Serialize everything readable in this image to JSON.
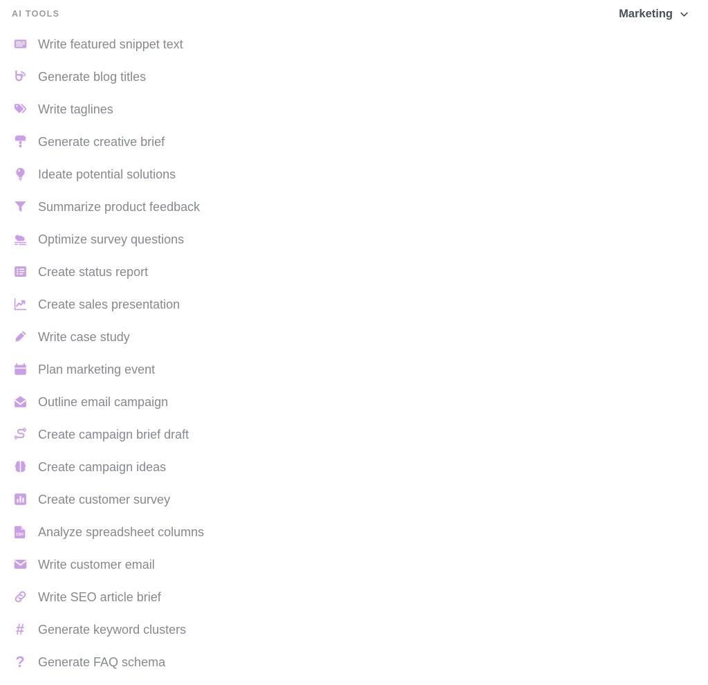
{
  "header": {
    "title": "AI TOOLS",
    "category": {
      "selected": "Marketing",
      "chevron_icon": "chevron-down-icon"
    }
  },
  "colors": {
    "icon_purple": "#c9a0e8",
    "label_gray": "#86888e",
    "title_gray": "#9a9aa2",
    "select_gray": "#4b4f58",
    "background": "#ffffff"
  },
  "tools": [
    {
      "label": "Write featured snippet text",
      "icon": "snippet-card-icon"
    },
    {
      "label": "Generate blog titles",
      "icon": "blog-rss-icon"
    },
    {
      "label": "Write taglines",
      "icon": "tags-icon"
    },
    {
      "label": "Generate creative brief",
      "icon": "paint-brush-icon"
    },
    {
      "label": "Ideate potential solutions",
      "icon": "lightbulb-icon"
    },
    {
      "label": "Summarize product feedback",
      "icon": "funnel-icon"
    },
    {
      "label": "Optimize survey questions",
      "icon": "cloud-icon"
    },
    {
      "label": "Create status report",
      "icon": "list-report-icon"
    },
    {
      "label": "Create sales presentation",
      "icon": "chart-line-up-icon"
    },
    {
      "label": "Write case study",
      "icon": "pencil-icon"
    },
    {
      "label": "Plan marketing event",
      "icon": "calendar-icon"
    },
    {
      "label": "Outline email campaign",
      "icon": "envelope-open-icon"
    },
    {
      "label": "Create campaign brief draft",
      "icon": "route-pins-icon"
    },
    {
      "label": "Create campaign ideas",
      "icon": "brain-icon"
    },
    {
      "label": "Create customer survey",
      "icon": "bar-chart-square-icon"
    },
    {
      "label": "Analyze spreadsheet columns",
      "icon": "csv-file-icon"
    },
    {
      "label": "Write customer email",
      "icon": "envelope-icon"
    },
    {
      "label": "Write SEO article brief",
      "icon": "link-chain-icon"
    },
    {
      "label": "Generate keyword clusters",
      "icon": "hash-icon"
    },
    {
      "label": "Generate FAQ schema",
      "icon": "question-mark-icon"
    }
  ]
}
